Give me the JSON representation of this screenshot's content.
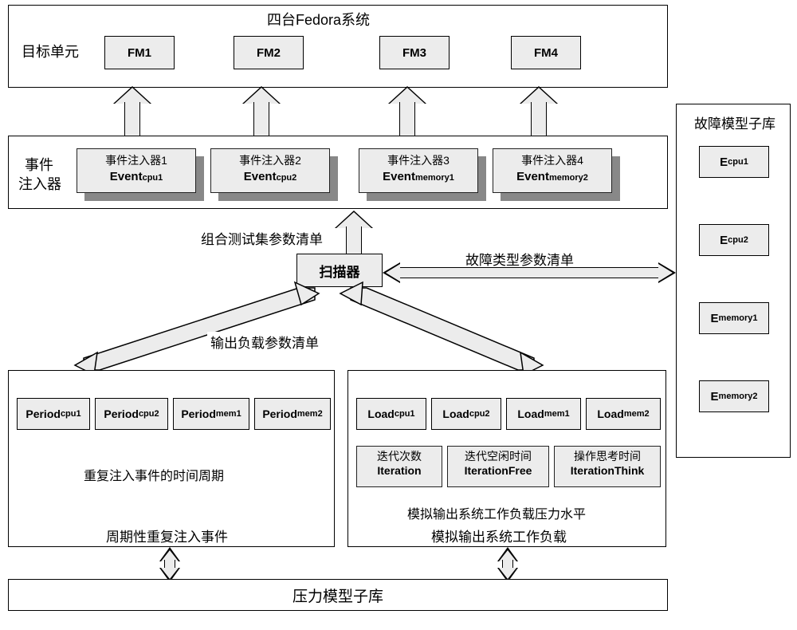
{
  "top": {
    "title": "四台Fedora系统",
    "side_label": "目标单元",
    "fm": [
      "FM1",
      "FM2",
      "FM3",
      "FM4"
    ]
  },
  "injectors": {
    "side1": "事件",
    "side2": "注入器",
    "items": [
      {
        "t": "事件注入器1",
        "e": "Event",
        "sub": "cpu1"
      },
      {
        "t": "事件注入器2",
        "e": "Event",
        "sub": "cpu2"
      },
      {
        "t": "事件注入器3",
        "e": "Event",
        "sub": "memory1"
      },
      {
        "t": "事件注入器4",
        "e": "Event",
        "sub": "memory2"
      }
    ]
  },
  "labels": {
    "combo": "组合测试集参数清单",
    "fault_params": "故障类型参数清单",
    "out_load": "输出负载参数清单"
  },
  "scanner": "扫描器",
  "fault_lib": {
    "title": "故障模型子库",
    "items": [
      {
        "e": "E",
        "sub": "cpu1"
      },
      {
        "e": "E",
        "sub": "cpu2"
      },
      {
        "e": "E",
        "sub": "memory1"
      },
      {
        "e": "E",
        "sub": "memory2"
      }
    ]
  },
  "periods": {
    "items": [
      {
        "p": "Period",
        "sub": "cpu1"
      },
      {
        "p": "Period",
        "sub": "cpu2"
      },
      {
        "p": "Period",
        "sub": "mem1"
      },
      {
        "p": "Period",
        "sub": "mem2"
      }
    ],
    "caption": "重复注入事件的时间周期",
    "footer": "周期性重复注入事件"
  },
  "loads": {
    "items": [
      {
        "p": "Load",
        "sub": "cpu1"
      },
      {
        "p": "Load",
        "sub": "cpu2"
      },
      {
        "p": "Load",
        "sub": "mem1"
      },
      {
        "p": "Load",
        "sub": "mem2"
      }
    ],
    "row2": [
      {
        "c": "迭代次数",
        "e": "Iteration"
      },
      {
        "c": "迭代空闲时间",
        "e": "IterationFree"
      },
      {
        "c": "操作思考时间",
        "e": "IterationThink"
      }
    ],
    "caption": "模拟输出系统工作负载压力水平",
    "footer": "模拟输出系统工作负载"
  },
  "press_lib": "压力模型子库"
}
